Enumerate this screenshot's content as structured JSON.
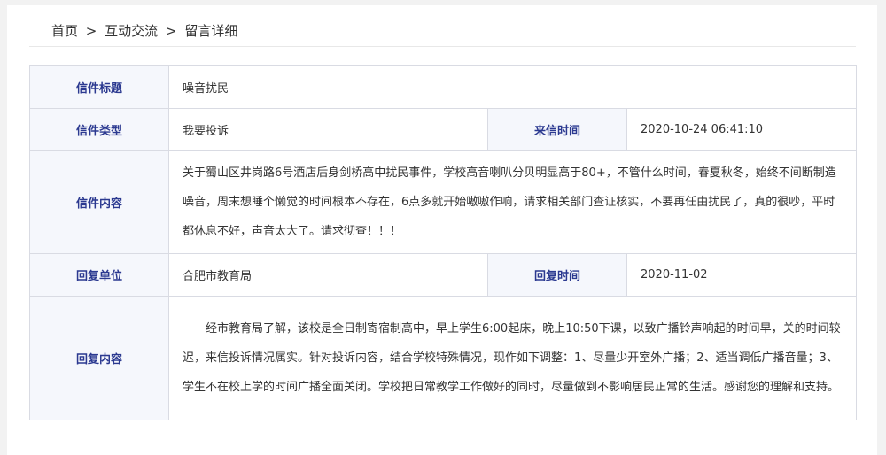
{
  "breadcrumb": [
    "首页",
    "互动交流",
    "留言详细"
  ],
  "breadcrumb_sep": ">",
  "labels": {
    "title": "信件标题",
    "type": "信件类型",
    "time": "来信时间",
    "content": "信件内容",
    "reply_unit": "回复单位",
    "reply_time": "回复时间",
    "reply_content": "回复内容"
  },
  "letter": {
    "title": "噪音扰民",
    "type": "我要投诉",
    "time": "2020-10-24 06:41:10",
    "content": "关于蜀山区井岗路6号酒店后身剑桥高中扰民事件，学校高音喇叭分贝明显高于80+，不管什么时间，春夏秋冬，始终不间断制造噪音，周末想睡个懒觉的时间根本不存在，6点多就开始嗷嗷作响，请求相关部门查证核实，不要再任由扰民了，真的很吵，平时都休息不好，声音太大了。请求彻查！！！",
    "reply_unit": "合肥市教育局",
    "reply_time": "2020-11-02",
    "reply_content": "经市教育局了解，该校是全日制寄宿制高中，早上学生6:00起床，晚上10:50下课，以致广播铃声响起的时间早，关的时间较迟，来信投诉情况属实。针对投诉内容，结合学校特殊情况，现作如下调整：1、尽量少开室外广播；2、适当调低广播音量；3、学生不在校上学的时间广播全面关闭。学校把日常教学工作做好的同时，尽量做到不影响居民正常的生活。感谢您的理解和支持。"
  }
}
